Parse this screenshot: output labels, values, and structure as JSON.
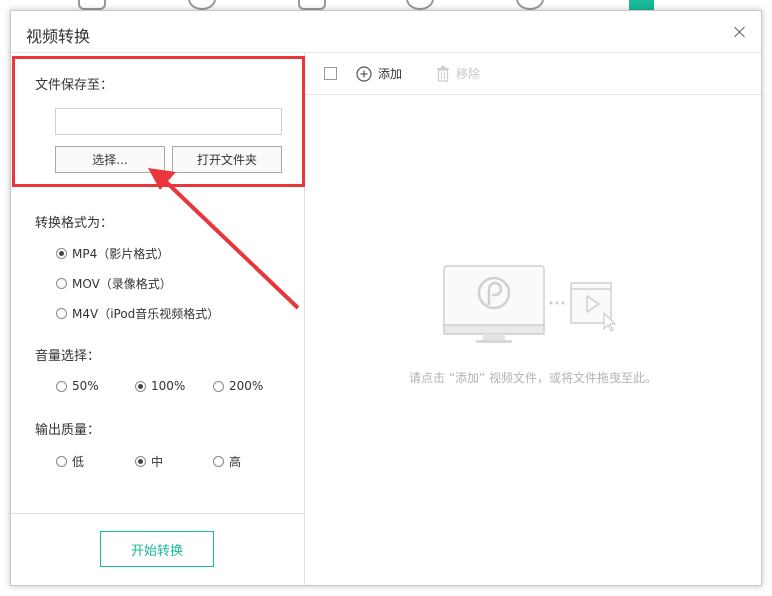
{
  "dialog": {
    "title": "视频转换",
    "close_icon": "close-icon"
  },
  "save": {
    "label": "文件保存至：",
    "path_value": "",
    "choose_label": "选择...",
    "open_folder_label": "打开文件夹"
  },
  "format": {
    "label": "转换格式为：",
    "options": [
      {
        "label": "MP4（影片格式）",
        "checked": true
      },
      {
        "label": "MOV（录像格式）",
        "checked": false
      },
      {
        "label": "M4V（iPod音乐视频格式）",
        "checked": false
      }
    ]
  },
  "volume": {
    "label": "音量选择：",
    "options": [
      {
        "label": "50%",
        "checked": false
      },
      {
        "label": "100%",
        "checked": true
      },
      {
        "label": "200%",
        "checked": false
      }
    ]
  },
  "quality": {
    "label": "输出质量：",
    "options": [
      {
        "label": "低",
        "checked": false
      },
      {
        "label": "中",
        "checked": true
      },
      {
        "label": "高",
        "checked": false
      }
    ]
  },
  "start_label": "开始转换",
  "toolbar": {
    "add_label": "添加",
    "remove_label": "移除"
  },
  "empty_hint": "请点击 “添加” 视频文件，或将文件拖曳至此。",
  "colors": {
    "accent": "#19b99a",
    "annotation": "#e8363a"
  }
}
